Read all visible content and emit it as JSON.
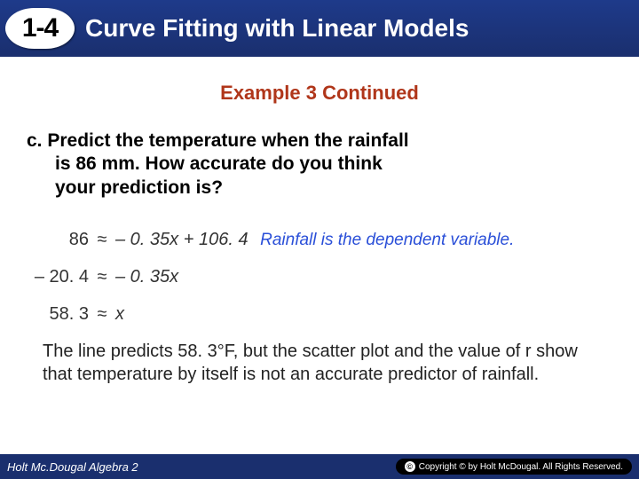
{
  "header": {
    "lesson_number": "1-4",
    "title": "Curve Fitting with Linear Models"
  },
  "example_title": "Example 3 Continued",
  "question": {
    "label": "c.",
    "line1": "Predict the temperature when the rainfall",
    "line2": "is 86 mm. How accurate do you think",
    "line3": "your prediction is?"
  },
  "work": {
    "row1_left": "86",
    "row1_approx": "≈",
    "row1_right": "– 0. 35x + 106. 4",
    "row1_hint": "Rainfall is the dependent variable.",
    "row2_left": "– 20. 4",
    "row2_approx": "≈",
    "row2_right": "– 0. 35x",
    "row3_left": "58. 3",
    "row3_approx": "≈",
    "row3_right": "x"
  },
  "explanation": "The line predicts 58. 3°F, but the scatter plot and the value of r show that temperature by itself is not an accurate predictor of rainfall.",
  "footer": {
    "textbook": "Holt Mc.Dougal Algebra 2",
    "copyright": "Copyright © by Holt McDougal. All Rights Reserved."
  }
}
